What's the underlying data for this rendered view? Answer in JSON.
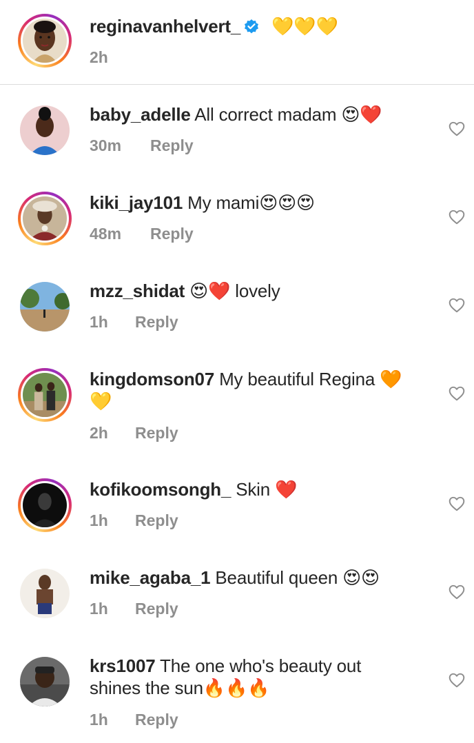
{
  "post": {
    "username": "reginavanhelvert_",
    "verified": true,
    "caption": "💛💛💛",
    "time": "2h"
  },
  "comments": [
    {
      "username": "baby_adelle",
      "text": "All correct madam 😍❤️",
      "text2": "",
      "time": "30m",
      "reply": "Reply",
      "ring": false
    },
    {
      "username": "kiki_jay101",
      "text": "My mami😍😍😍",
      "text2": "",
      "time": "48m",
      "reply": "Reply",
      "ring": true
    },
    {
      "username": "mzz_shidat",
      "text": "😍❤️ lovely",
      "text2": "",
      "time": "1h",
      "reply": "Reply",
      "ring": false
    },
    {
      "username": "kingdomson07",
      "text": "My beautiful Regina 🧡",
      "text2": "💛",
      "time": "2h",
      "reply": "Reply",
      "ring": true
    },
    {
      "username": "kofikoomsongh_",
      "text": "Skin ❤️",
      "text2": "",
      "time": "1h",
      "reply": "Reply",
      "ring": true
    },
    {
      "username": "mike_agaba_1",
      "text": "Beautiful queen 😍😍",
      "text2": "",
      "time": "1h",
      "reply": "Reply",
      "ring": false
    },
    {
      "username": "krs1007",
      "text": "The one who's beauty out",
      "text2": "shines the sun🔥🔥🔥",
      "time": "1h",
      "reply": "Reply",
      "ring": false
    }
  ],
  "colors": {
    "text": "#262626",
    "muted": "#8e8e8e",
    "verified": "#1d9bf0",
    "divider": "#dbdbdb"
  },
  "icons": {
    "like": "heart-outline-icon",
    "verified": "verified-badge-icon"
  }
}
